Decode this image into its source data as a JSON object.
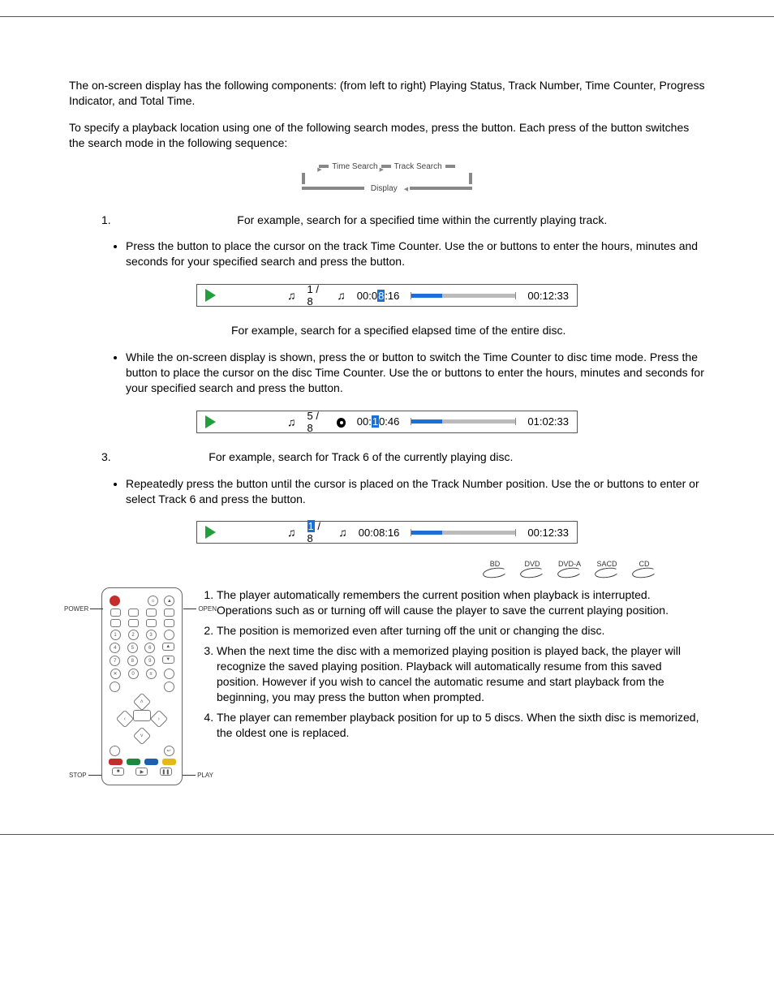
{
  "intro1": "The on-screen display has the following components: (from left to right) Playing Status, Track Number, Time Counter, Progress Indicator, and Total Time.",
  "intro2a": "To specify a playback location using one of the following search modes, press the ",
  "intro2b": " button.  Each press of the ",
  "intro2c": " button switches the search mode in the following sequence:",
  "cycle": {
    "time": "Time Search",
    "track": "Track Search",
    "display": "Display"
  },
  "sec1": {
    "lead": "For example, search for a specified time within the currently playing track.",
    "b1a": "Press the ",
    "b1b": " button to place the cursor on the track Time Counter.   Use the ",
    "b1c": " or ",
    "b1d": " buttons to enter the hours, minutes and seconds for your specified search and press the ",
    "b1e": " button.",
    "osd": {
      "track": "1 / 8",
      "t1a": "00:0",
      "t1h": "8",
      "t1b": ":16",
      "total": "00:12:33"
    }
  },
  "sec2": {
    "lead": "For example, search for a specified elapsed time of the entire disc.",
    "b1a": "While the on-screen display is shown, press the ",
    "b1b": " or ",
    "b1c": " button to switch the Time Counter to disc time mode.  Press the ",
    "b1d": " button to place the cursor on the disc Time Counter.  Use the ",
    "b1e": " or ",
    "b1f": " buttons to enter the hours, minutes and seconds for your specified search and press the ",
    "b1g": " button.",
    "osd": {
      "track": "5 / 8",
      "t1a": "00:",
      "t1h": "1",
      "t1b": "0:46",
      "total": "01:02:33"
    }
  },
  "sec3": {
    "num": "3.",
    "lead": "For example, search for Track 6 of the currently playing disc.",
    "b1a": "Repeatedly press the ",
    "b1b": " button until the cursor is placed on the Track Number position.  Use the ",
    "b1c": " or ",
    "b1d": " buttons to enter or select Track 6 and press the ",
    "b1e": " button.",
    "osd": {
      "trka": "",
      "trkh": "1",
      "trkb": " / 8",
      "time": "00:08:16",
      "total": "00:12:33"
    }
  },
  "discs": [
    "BD",
    "DVD",
    "DVD-A",
    "SACD",
    "CD"
  ],
  "remote": {
    "power": "POWER",
    "open": "OPEN",
    "stop": "STOP",
    "play": "PLAY"
  },
  "mem": {
    "i1a": "The player automatically remembers the current position when playback is interrupted.  Operations such as ",
    "i1b": " or turning ",
    "i1c": " off will cause the player to save the current playing position.",
    "i2": "The position is memorized even after turning off the unit or changing the disc.",
    "i3a": "When the next time the disc with a memorized playing position is played back, the player will recognize the saved playing position.  Playback will automatically resume from this saved position.  However if you wish to cancel the automatic resume and start playback from the beginning, you may press the ",
    "i3b": " button when prompted.",
    "i4": "The player can remember playback position for up to 5 discs.  When the sixth disc is memorized, the oldest one is replaced."
  }
}
